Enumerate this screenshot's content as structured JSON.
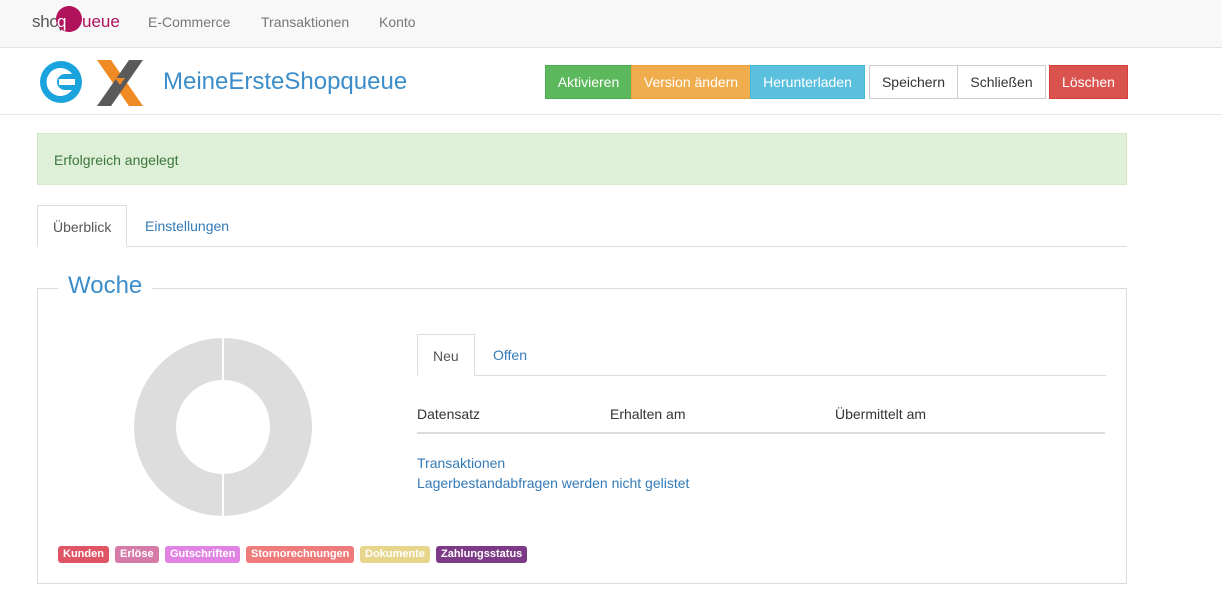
{
  "navbar": {
    "brand_left": "shop",
    "brand_q": "q",
    "brand_right": "ueue",
    "links": [
      "E-Commerce",
      "Transaktionen",
      "Konto"
    ]
  },
  "header": {
    "title": "MeineErsteShopqueue",
    "buttons": {
      "activate": "Aktivieren",
      "change_version": "Version ändern",
      "download": "Herunterladen",
      "save": "Speichern",
      "close": "Schließen",
      "delete": "Löschen"
    }
  },
  "alert": {
    "text": "Erfolgreich angelegt"
  },
  "tabs": [
    {
      "label": "Überblick",
      "active": true
    },
    {
      "label": "Einstellungen",
      "active": false
    }
  ],
  "week": {
    "legend": "Woche",
    "chart_data": {
      "type": "pie",
      "categories": [
        "Kunden",
        "Erlöse",
        "Gutschriften",
        "Stornorechnungen",
        "Dokumente",
        "Zahlungsstatus"
      ],
      "values": [
        0,
        0,
        0,
        0,
        0,
        0
      ],
      "colors": [
        "#e05565",
        "#d67aa8",
        "#e083e3",
        "#ef7b7b",
        "#e6d58a",
        "#7d3a86"
      ],
      "empty_color": "#dddddd"
    },
    "inner_tabs": [
      {
        "label": "Neu",
        "active": true
      },
      {
        "label": "Offen",
        "active": false
      }
    ],
    "columns": [
      "Datensatz",
      "Erhalten am",
      "Übermittelt am"
    ],
    "links": [
      "Transaktionen",
      "Lagerbestandabfragen werden nicht gelistet"
    ]
  }
}
